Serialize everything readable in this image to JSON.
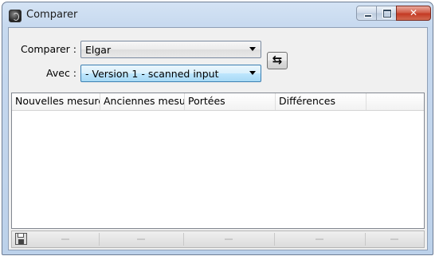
{
  "window": {
    "title": "Comparer"
  },
  "form": {
    "comparer_label": "Comparer :",
    "comparer_value": "Elgar",
    "avec_label": "Avec :",
    "avec_value": "- Version 1 - scanned input"
  },
  "table": {
    "columns": [
      "Nouvelles mesures",
      "Anciennes mesures",
      "Portées",
      "Différences",
      ""
    ]
  },
  "icons": {
    "swap": "swap-arrows-icon",
    "save": "save-icon",
    "app": "app-logo-icon"
  }
}
